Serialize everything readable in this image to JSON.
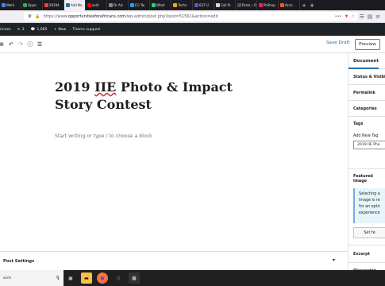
{
  "browser": {
    "tabs": [
      {
        "label": "Work",
        "color": "#4285f4",
        "active": false
      },
      {
        "label": "Oppo",
        "color": "#34a853",
        "active": false
      },
      {
        "label": "20194",
        "color": "#ea4335",
        "active": false
      },
      {
        "label": "Add Ne",
        "color": "#21759b",
        "active": true
      },
      {
        "label": "avid",
        "color": "#ff0000",
        "active": false
      },
      {
        "label": "Dr Alc",
        "color": "#888888",
        "active": false
      },
      {
        "label": "(1) Tw",
        "color": "#1da1f2",
        "active": false
      },
      {
        "label": "What",
        "color": "#25d366",
        "active": false
      },
      {
        "label": "Techn",
        "color": "#f5a623",
        "active": false
      },
      {
        "label": "637 U",
        "color": "#6b4fbb",
        "active": false
      },
      {
        "label": "Call N",
        "color": "#d6d6d6",
        "active": false
      },
      {
        "label": "Posts ‹ Op",
        "color": "#555555",
        "active": false
      },
      {
        "label": "PoShop",
        "color": "#e91e63",
        "active": false
      },
      {
        "label": "Acco",
        "color": "#ff5722",
        "active": false
      }
    ],
    "url_prefix": "https://www.",
    "url_domain": "opportunitiesforafricans.com",
    "url_path": "/wp-admin/post.php?post=51561&action=edit",
    "url_more": "•••"
  },
  "adminbar": {
    "site": "ricans",
    "updates": "3",
    "comments": "1,065",
    "new_label": "New",
    "theme_support": "Themv support"
  },
  "toolbar": {
    "save_draft": "Save Draft",
    "preview": "Preview"
  },
  "editor": {
    "title_word1": "2019 ",
    "title_spell": "IIE",
    "title_rest": " Photo & Impact Story Contest",
    "placeholder": "Start writing or type / to choose a block"
  },
  "sidebar": {
    "tab_document": "Document",
    "status_visibility": "Status & Visibili",
    "permalink": "Permalink",
    "categories": "Categories",
    "tags": "Tags",
    "add_new_tag": "Add New Tag",
    "tag_value": "2019 IIE Pho",
    "featured_image": "Featured Image",
    "notice_line1": "Selecting a",
    "notice_line2": "image is re",
    "notice_line3": "for an optir",
    "notice_line4": "experience",
    "set_button": "Set fe",
    "excerpt": "Excerpt",
    "discussion": "Discussion"
  },
  "post_settings": {
    "label": "Post Settings"
  },
  "taskbar": {
    "search_label": "arch"
  }
}
